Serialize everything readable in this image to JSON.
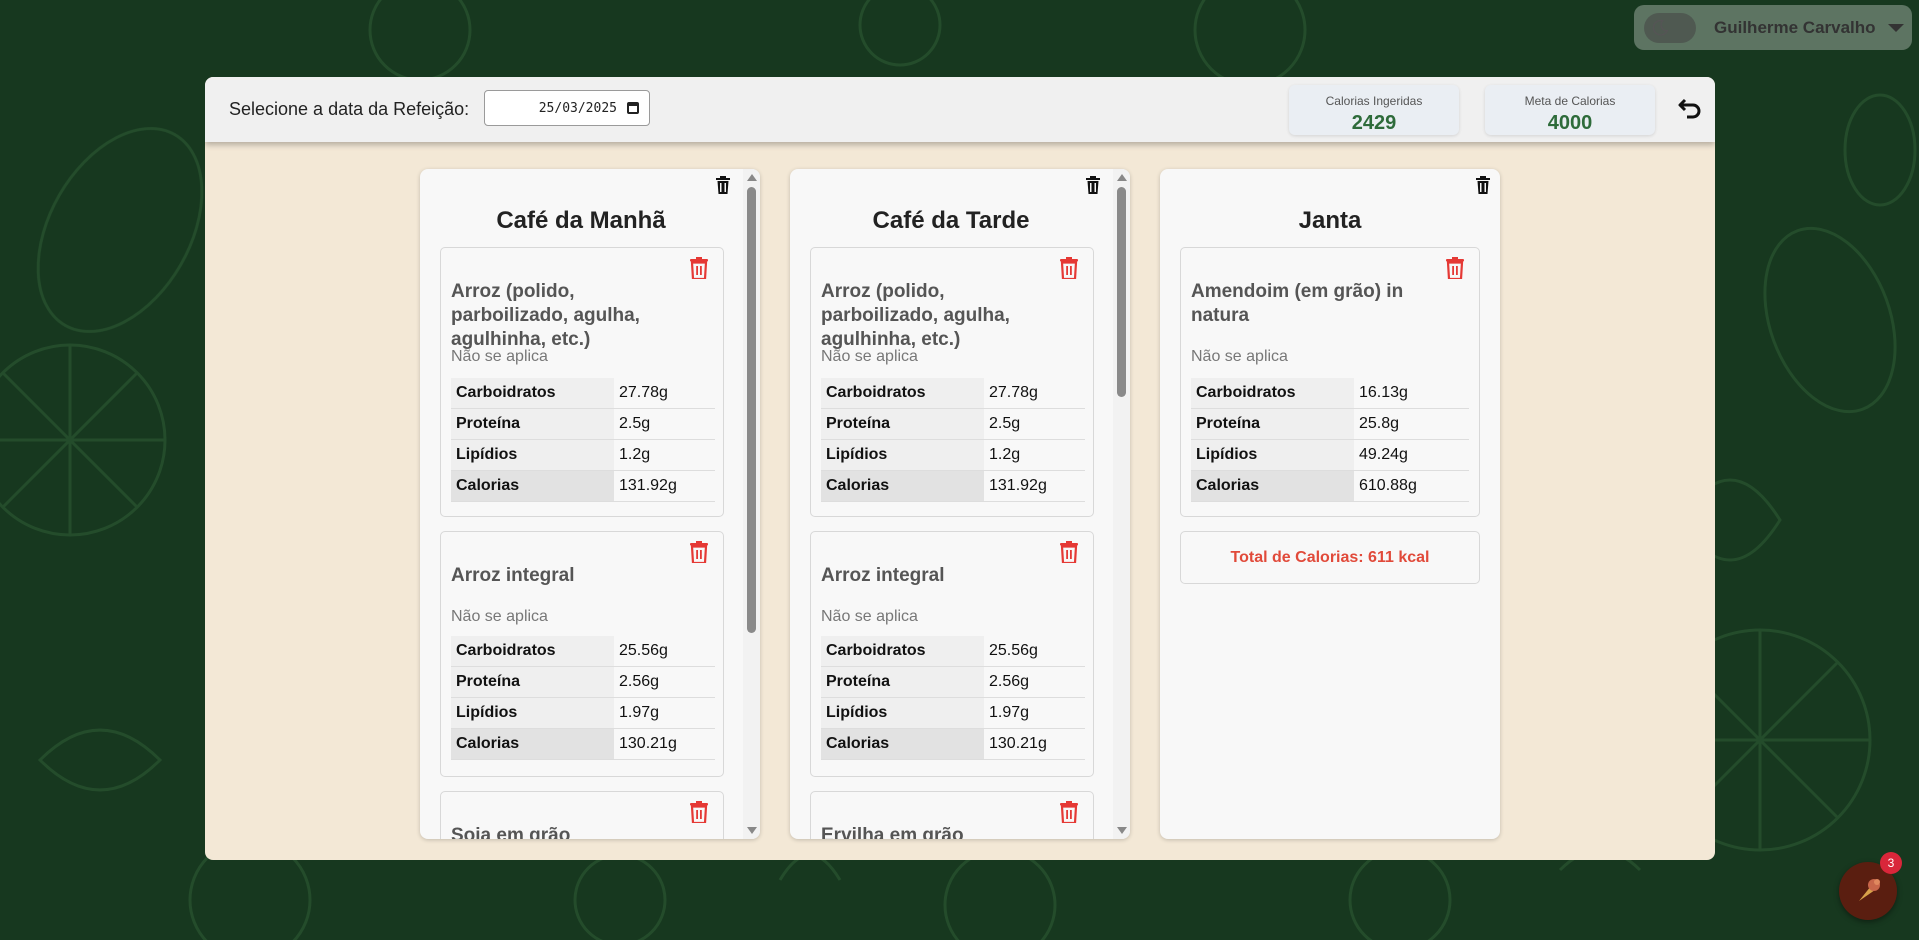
{
  "user": {
    "name": "Guilherme Carvalho",
    "theme_icon": "moon-icon"
  },
  "header": {
    "date_label": "Selecione a data da Refeição:",
    "date_value": "25/03/2025",
    "stats": [
      {
        "label": "Calorias Ingeridas",
        "value": "2429"
      },
      {
        "label": "Meta de Calorias",
        "value": "4000"
      }
    ]
  },
  "meals": [
    {
      "title": "Café da Manhã",
      "foods": [
        {
          "name": "Arroz (polido, parboilizado, agulha, agulhinha, etc.)",
          "sub": "Não se aplica",
          "rows": [
            {
              "k": "Carboidratos",
              "v": "27.78g"
            },
            {
              "k": "Proteína",
              "v": "2.5g"
            },
            {
              "k": "Lipídios",
              "v": "1.2g"
            },
            {
              "k": "Calorias",
              "v": "131.92g"
            }
          ]
        },
        {
          "name": "Arroz integral",
          "sub": "Não se aplica",
          "rows": [
            {
              "k": "Carboidratos",
              "v": "25.56g"
            },
            {
              "k": "Proteína",
              "v": "2.56g"
            },
            {
              "k": "Lipídios",
              "v": "1.97g"
            },
            {
              "k": "Calorias",
              "v": "130.21g"
            }
          ]
        },
        {
          "name": "Soja em grão"
        }
      ]
    },
    {
      "title": "Café da Tarde",
      "foods": [
        {
          "name": "Arroz (polido, parboilizado, agulha, agulhinha, etc.)",
          "sub": "Não se aplica",
          "rows": [
            {
              "k": "Carboidratos",
              "v": "27.78g"
            },
            {
              "k": "Proteína",
              "v": "2.5g"
            },
            {
              "k": "Lipídios",
              "v": "1.2g"
            },
            {
              "k": "Calorias",
              "v": "131.92g"
            }
          ]
        },
        {
          "name": "Arroz integral",
          "sub": "Não se aplica",
          "rows": [
            {
              "k": "Carboidratos",
              "v": "25.56g"
            },
            {
              "k": "Proteína",
              "v": "2.56g"
            },
            {
              "k": "Lipídios",
              "v": "1.97g"
            },
            {
              "k": "Calorias",
              "v": "130.21g"
            }
          ]
        },
        {
          "name": "Ervilha em grão"
        }
      ]
    },
    {
      "title": "Janta",
      "foods": [
        {
          "name": "Amendoim (em grão) in natura",
          "sub": "Não se aplica",
          "rows": [
            {
              "k": "Carboidratos",
              "v": "16.13g"
            },
            {
              "k": "Proteína",
              "v": "25.8g"
            },
            {
              "k": "Lipídios",
              "v": "49.24g"
            },
            {
              "k": "Calorias",
              "v": "610.88g"
            }
          ]
        }
      ],
      "total": "Total de Calorias: 611 kcal"
    }
  ],
  "fab": {
    "icon": "ice-cream-icon",
    "badge": "3"
  }
}
